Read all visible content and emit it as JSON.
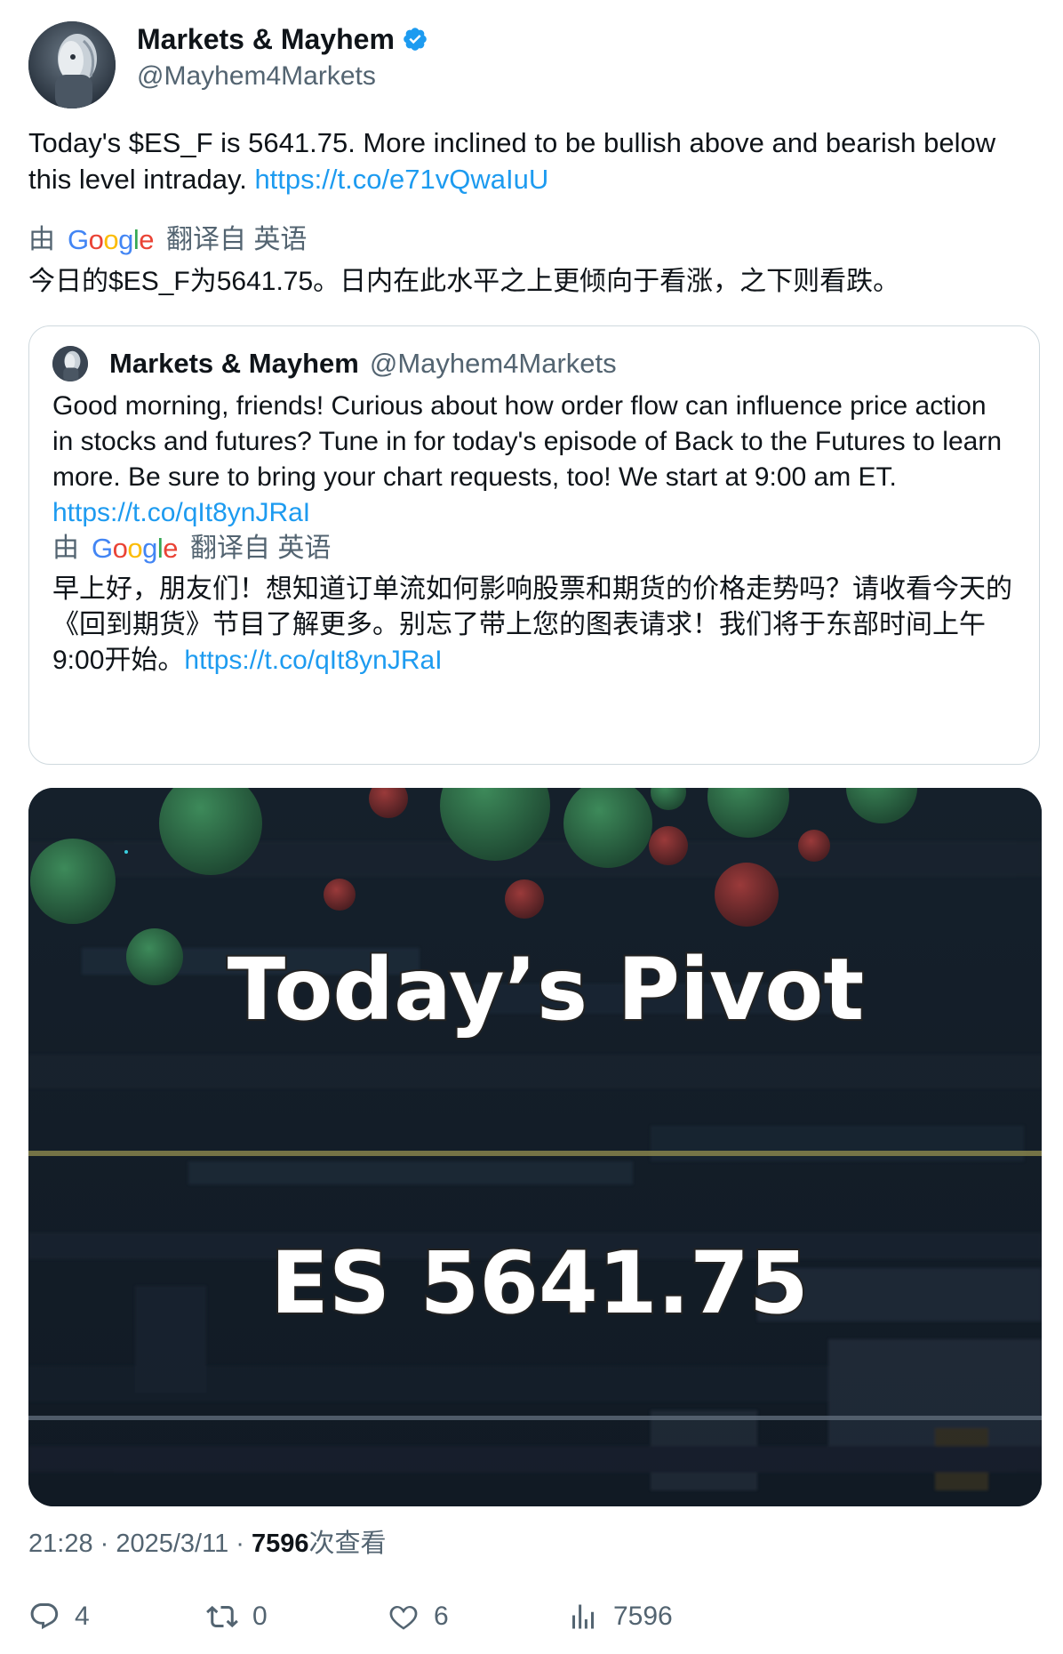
{
  "author": {
    "display_name": "Markets & Mayhem",
    "handle": "@Mayhem4Markets",
    "verified_icon": "verified-badge-icon"
  },
  "tweet": {
    "text": "Today's $ES_F is 5641.75. More inclined to be bullish above and bearish below this level intraday. ",
    "link": "https://t.co/e71vQwaIuU",
    "translate": {
      "prefix": "由",
      "provider": "Google",
      "suffix": "翻译自 英语",
      "text": "今日的$ES_F为5641.75。日内在此水平之上更倾向于看涨，之下则看跌。"
    }
  },
  "quote": {
    "display_name": "Markets & Mayhem",
    "handle": "@Mayhem4Markets",
    "text": "Good morning, friends! Curious about how order flow can influence price action in stocks and futures? Tune in for today's episode of Back to the Futures to learn more. Be sure to bring your chart requests, too! We start at 9:00 am ET. ",
    "link": "https://t.co/qIt8ynJRaI",
    "translate": {
      "prefix": "由",
      "provider": "Google",
      "suffix": "翻译自 英语",
      "text": "早上好，朋友们！想知道订单流如何影响股票和期货的价格走势吗？请收看今天的《回到期货》节目了解更多。别忘了带上您的图表请求！我们将于东部时间上午9:00开始。",
      "link": "https://t.co/qIt8ynJRaI"
    }
  },
  "media": {
    "title": "Today’s Pivot",
    "level": "ES 5641.75"
  },
  "meta": {
    "time": "21:28",
    "sep1": " · ",
    "date": "2025/3/11",
    "sep2": " · ",
    "views_count": "7596",
    "views_label": "次查看"
  },
  "actions": {
    "replies": "4",
    "reposts": "0",
    "likes": "6",
    "views": "7596"
  },
  "colors": {
    "link": "#1d9bf0",
    "secondary_text": "#536471",
    "verified": "#1d9bf0",
    "border": "#cfd9de"
  }
}
